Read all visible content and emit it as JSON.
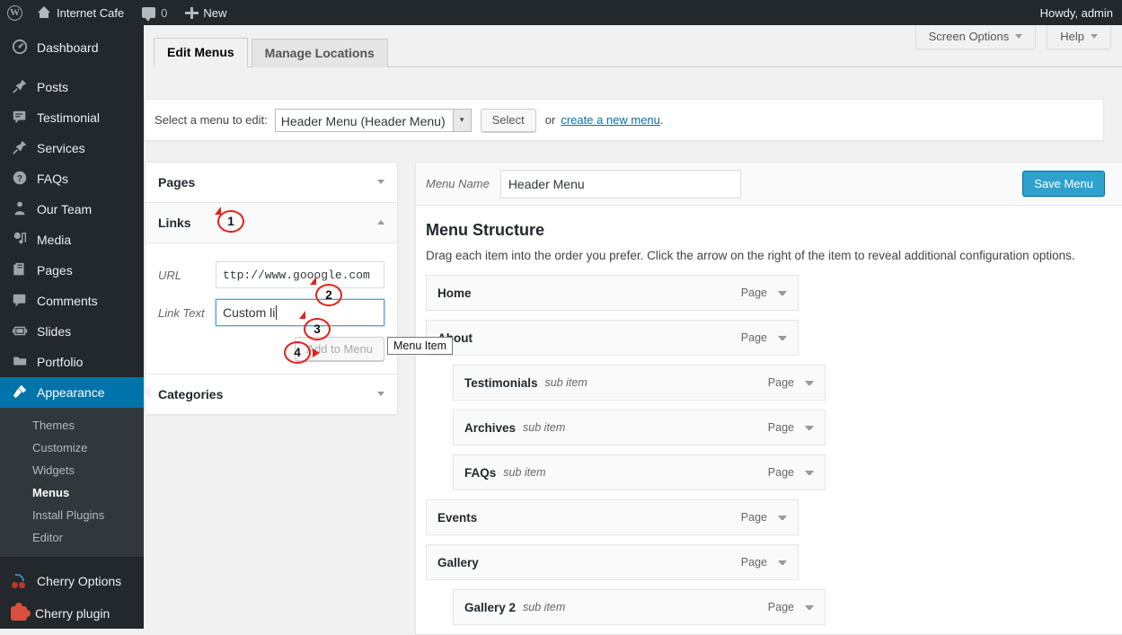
{
  "adminbar": {
    "logo_icon": "wordpress-logo-icon",
    "site_name": "Internet Cafe",
    "comments_icon": "comment-bubble-icon",
    "comments_count": "0",
    "new_icon": "plus-icon",
    "new_label": "New",
    "howdy": "Howdy, admin"
  },
  "sidebar": {
    "items": [
      {
        "label": "Dashboard",
        "icon": "dashboard-icon",
        "glyph": "◔"
      },
      {
        "label": "Posts",
        "icon": "pin-icon",
        "glyph": "✒"
      },
      {
        "label": "Testimonial",
        "icon": "speech-bubble-icon",
        "glyph": "▤"
      },
      {
        "label": "Services",
        "icon": "pin-icon",
        "glyph": "✒"
      },
      {
        "label": "FAQs",
        "icon": "question-circle-icon",
        "glyph": "?"
      },
      {
        "label": "Our Team",
        "icon": "person-icon",
        "glyph": "♟"
      },
      {
        "label": "Media",
        "icon": "media-icon",
        "glyph": "♫"
      },
      {
        "label": "Pages",
        "icon": "pages-icon",
        "glyph": "◫"
      },
      {
        "label": "Comments",
        "icon": "comment-bubble-icon",
        "glyph": "▬"
      },
      {
        "label": "Slides",
        "icon": "slides-icon",
        "glyph": "▥"
      },
      {
        "label": "Portfolio",
        "icon": "folder-icon",
        "glyph": "▰"
      },
      {
        "label": "Appearance",
        "icon": "paintbrush-icon",
        "glyph": "⚒",
        "current": true
      }
    ],
    "appearance_submenu": [
      {
        "label": "Themes"
      },
      {
        "label": "Customize"
      },
      {
        "label": "Widgets"
      },
      {
        "label": "Menus",
        "current": true
      },
      {
        "label": "Install Plugins"
      },
      {
        "label": "Editor"
      }
    ],
    "plugins": [
      {
        "label": "Cherry Options",
        "icon": "cherry-icon"
      },
      {
        "label": "Cherry plugin",
        "icon": "puzzle-piece-icon"
      }
    ],
    "accent_current": "#0073aa",
    "background": "#23282d",
    "submenu_background": "#32373c"
  },
  "screen_meta": {
    "screen_options_label": "Screen Options",
    "help_label": "Help",
    "caret_icon": "chevron-down-icon"
  },
  "tabs": [
    {
      "label": "Edit Menus",
      "active": true
    },
    {
      "label": "Manage Locations",
      "active": false
    }
  ],
  "menu_select_bar": {
    "label": "Select a menu to edit:",
    "selected_menu": "Header Menu (Header Menu)",
    "select_arrow_icon": "chevron-down-icon",
    "select_button": "Select",
    "or_text": "or",
    "create_link": "create a new menu",
    "period": "."
  },
  "accordion": {
    "panels": [
      {
        "title": "Pages",
        "open": false,
        "toggle_icon": "chevron-down-icon"
      },
      {
        "title": "Links",
        "open": true,
        "toggle_icon": "chevron-up-icon"
      },
      {
        "title": "Categories",
        "open": false,
        "toggle_icon": "chevron-down-icon"
      }
    ],
    "links_form": {
      "url_label": "URL",
      "url_value": "ttp://www.gooogle.com",
      "link_text_label": "Link Text",
      "link_text_value": "Custom li",
      "add_button": "Add to Menu"
    }
  },
  "menu_panel": {
    "name_label": "Menu Name",
    "name_value": "Header Menu",
    "save_button": "Save Menu",
    "save_button_color": "#2ea2cc",
    "structure_heading": "Menu Structure",
    "structure_description": "Drag each item into the order you prefer. Click the arrow on the right of the item to reveal additional configuration options.",
    "items": [
      {
        "title": "Home",
        "sub_label": "",
        "type": "Page",
        "depth": 0
      },
      {
        "title": "About",
        "sub_label": "",
        "type": "Page",
        "depth": 0
      },
      {
        "title": "Testimonials",
        "sub_label": "sub item",
        "type": "Page",
        "depth": 1
      },
      {
        "title": "Archives",
        "sub_label": "sub item",
        "type": "Page",
        "depth": 1
      },
      {
        "title": "FAQs",
        "sub_label": "sub item",
        "type": "Page",
        "depth": 1
      },
      {
        "title": "Events",
        "sub_label": "",
        "type": "Page",
        "depth": 0
      },
      {
        "title": "Gallery",
        "sub_label": "",
        "type": "Page",
        "depth": 0
      },
      {
        "title": "Gallery 2",
        "sub_label": "sub item",
        "type": "Page",
        "depth": 1
      }
    ]
  },
  "annotations": {
    "color": "#e32119",
    "steps": [
      {
        "number": "1"
      },
      {
        "number": "2"
      },
      {
        "number": "3"
      },
      {
        "number": "4"
      }
    ]
  },
  "tooltip": {
    "text": "Menu Item"
  }
}
